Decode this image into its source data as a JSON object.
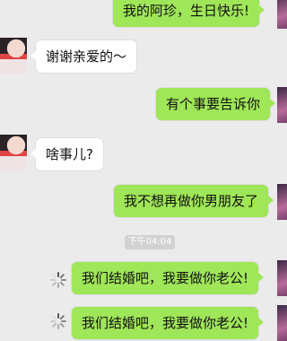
{
  "messages": [
    {
      "side": "out",
      "text": "我的阿珍，生日快乐!"
    },
    {
      "side": "in",
      "text": "谢谢亲爱的～"
    },
    {
      "side": "out",
      "text": "有个事要告诉你"
    },
    {
      "side": "in",
      "text": "啥事儿?"
    },
    {
      "side": "out",
      "text": "我不想再做你男朋友了"
    },
    {
      "side": "out",
      "text": "我们结婚吧，我要做你老公!"
    },
    {
      "side": "out",
      "text": "我们结婚吧，我要做你老公!"
    }
  ],
  "timestamp": "下午04:04",
  "colors": {
    "outgoing_bubble": "#9fe658",
    "incoming_bubble": "#ffffff",
    "background": "#ebebeb"
  },
  "icons": {
    "sending": "loading-spinner-icon"
  }
}
